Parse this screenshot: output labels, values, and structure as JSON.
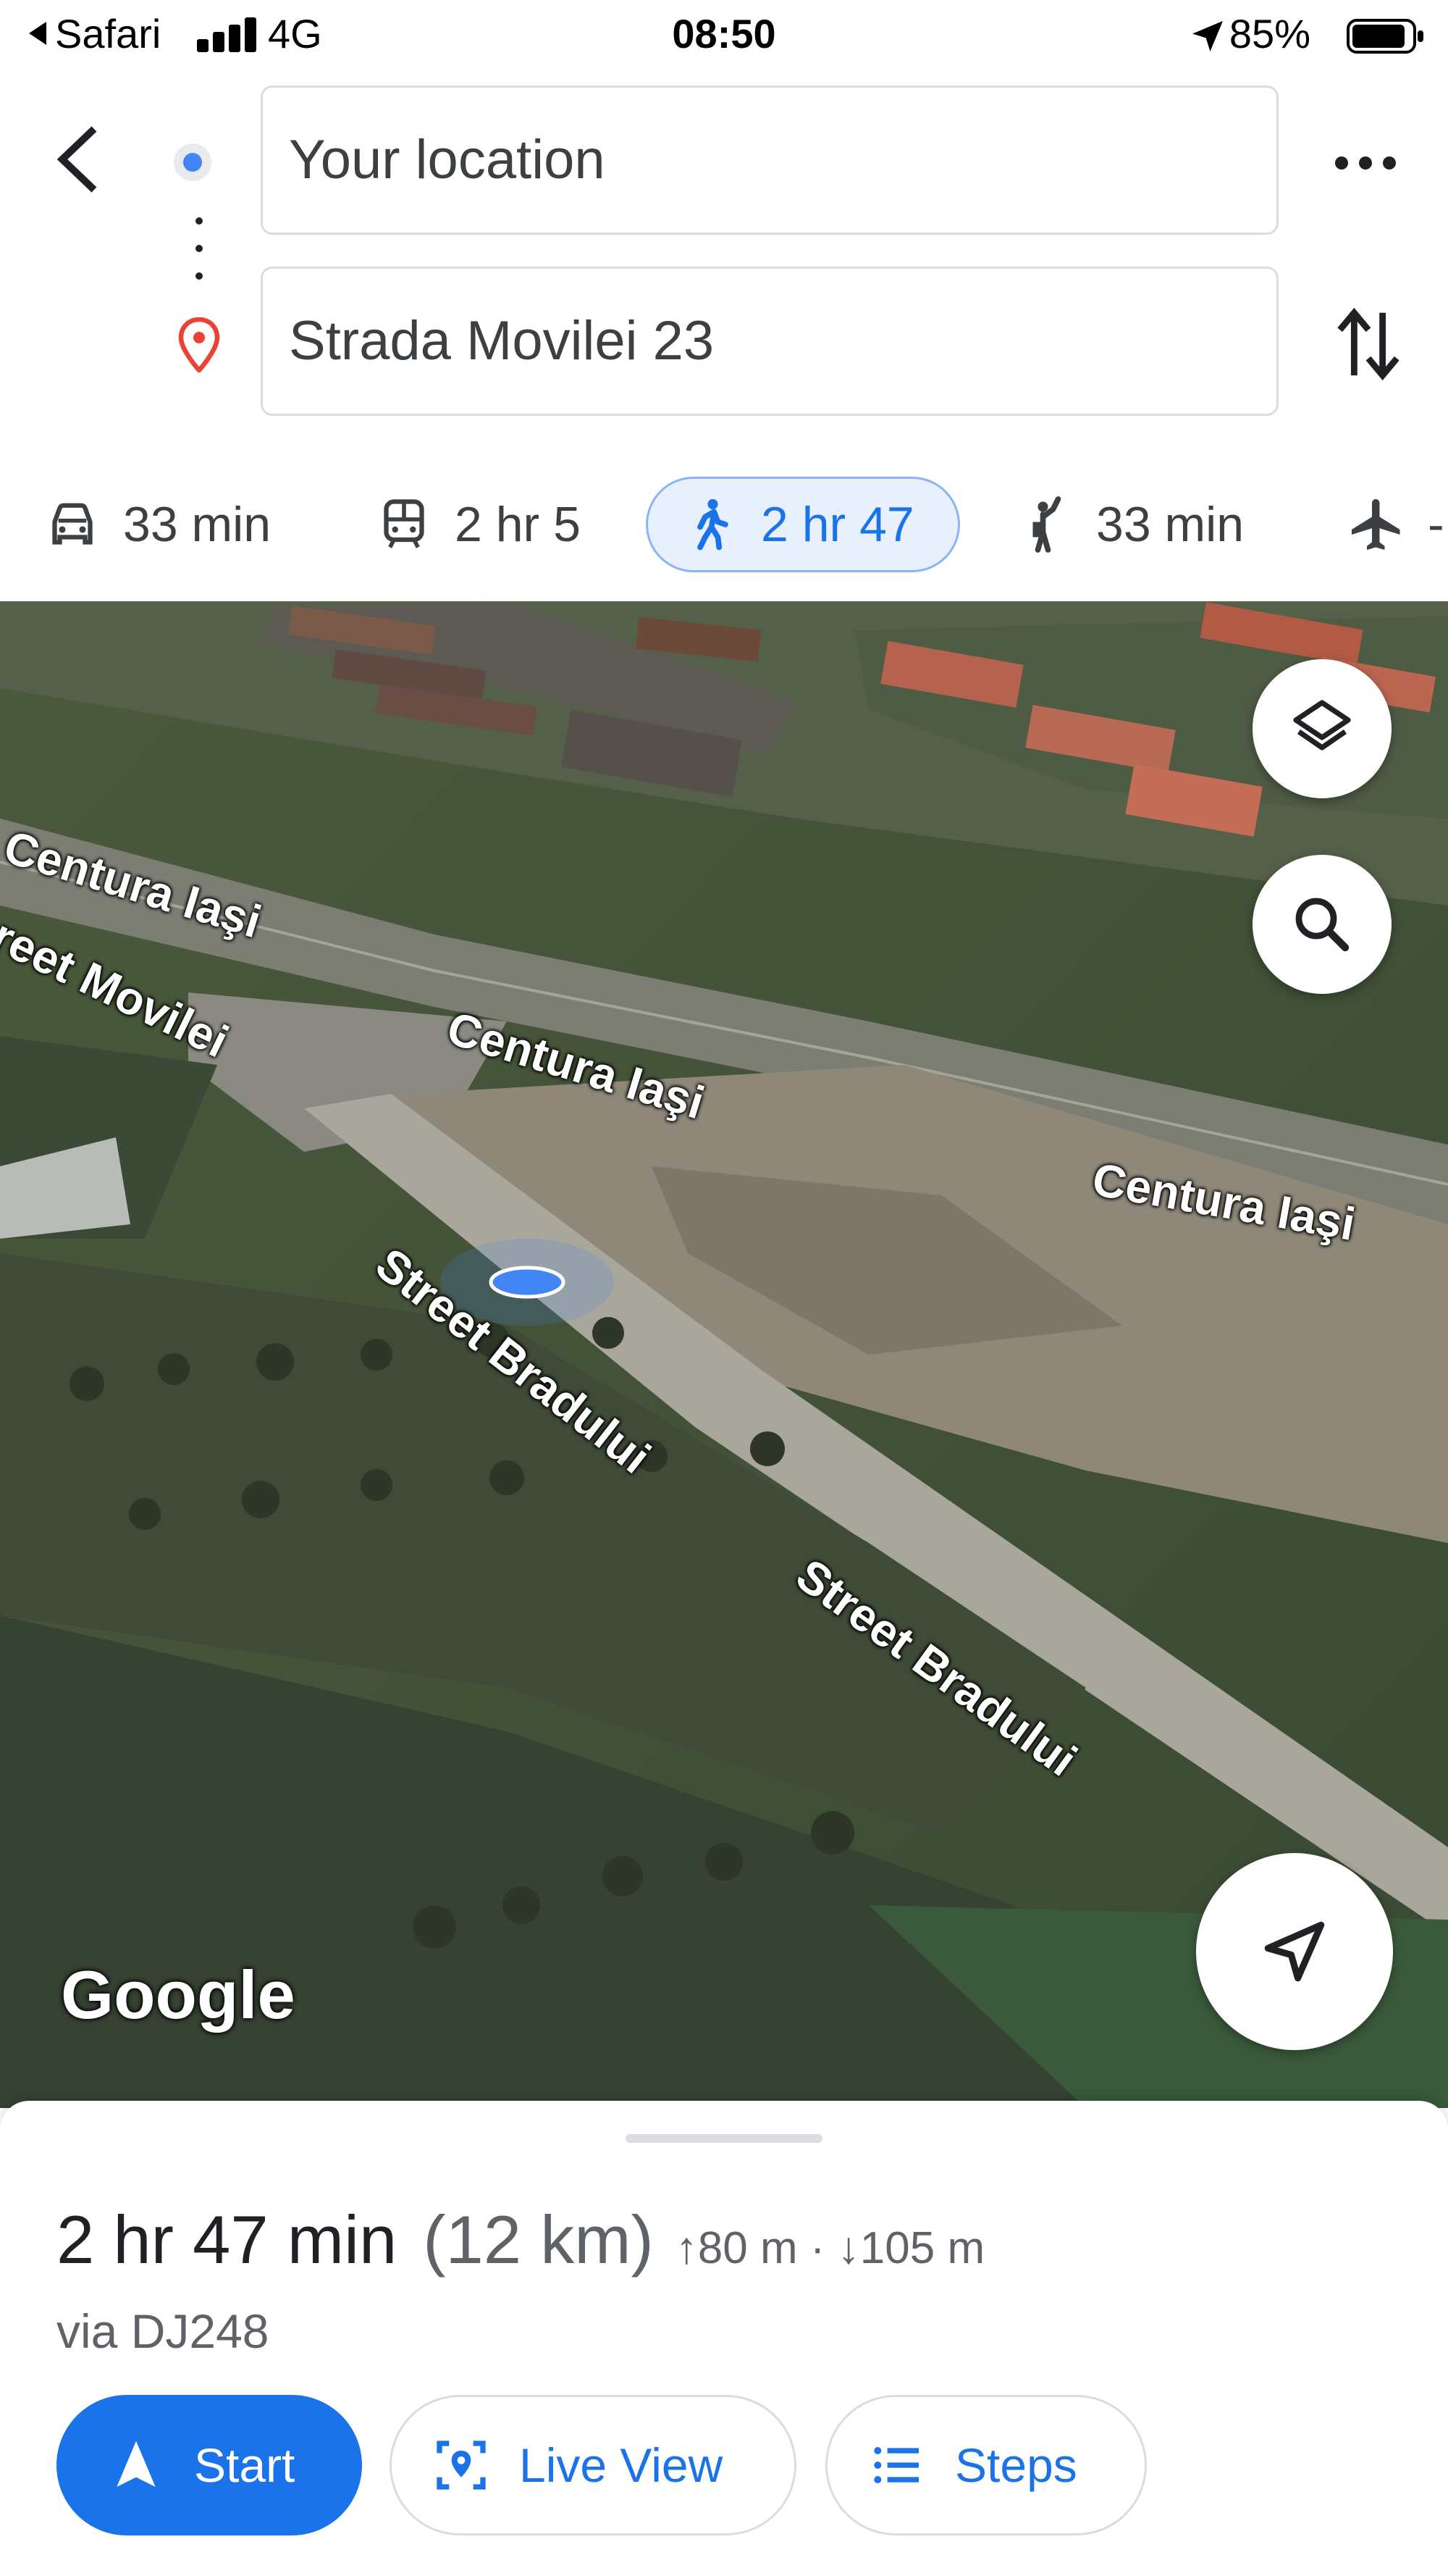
{
  "status_bar": {
    "back_app": "Safari",
    "network": "4G",
    "time": "08:50",
    "battery": "85%"
  },
  "search": {
    "origin": "Your location",
    "destination": "Strada Movilei 23"
  },
  "modes": [
    {
      "icon": "car-icon",
      "label": "33 min",
      "active": false
    },
    {
      "icon": "train-icon",
      "label": "2 hr 5",
      "active": false
    },
    {
      "icon": "walk-icon",
      "label": "2 hr 47",
      "active": true
    },
    {
      "icon": "ride-hail-icon",
      "label": "33 min",
      "active": false
    },
    {
      "icon": "flight-icon",
      "label": "-",
      "active": false
    }
  ],
  "map": {
    "labels": {
      "centura_1": "Centura Iaşi",
      "street_movilei": "reet Movilei",
      "centura_2": "Centura Iaşi",
      "centura_3": "Centura Iaşi",
      "bradului_1": "Street Bradului",
      "bradului_2": "Street Bradului"
    },
    "logo": "Google"
  },
  "route": {
    "duration": "2 hr 47 min",
    "distance": "(12 km)",
    "elevation_up": "80 m",
    "elevation_down": "105 m",
    "via": "via DJ248"
  },
  "actions": {
    "start": "Start",
    "live_view": "Live View",
    "steps": "Steps"
  },
  "colors": {
    "accent": "#1a73e8",
    "active_tab_bg": "#e8f0fe"
  }
}
